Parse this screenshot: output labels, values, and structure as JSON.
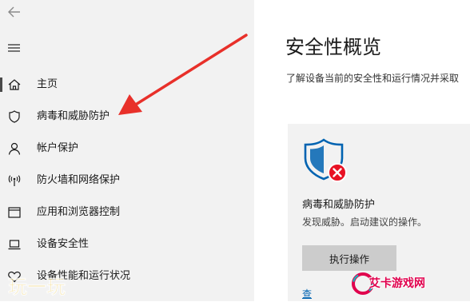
{
  "sidebar": {
    "items": [
      {
        "label": "主页",
        "icon": "home-icon",
        "active": true
      },
      {
        "label": "病毒和威胁防护",
        "icon": "shield-icon",
        "active": false
      },
      {
        "label": "帐户保护",
        "icon": "person-icon",
        "active": false
      },
      {
        "label": "防火墙和网络保护",
        "icon": "wifi-antenna-icon",
        "active": false
      },
      {
        "label": "应用和浏览器控制",
        "icon": "app-window-icon",
        "active": false
      },
      {
        "label": "设备安全性",
        "icon": "laptop-icon",
        "active": false
      },
      {
        "label": "设备性能和运行状况",
        "icon": "heart-icon",
        "active": false
      }
    ]
  },
  "main": {
    "title": "安全性概览",
    "subtitle": "了解设备当前的安全性和运行情况并采取",
    "card": {
      "title": "病毒和威胁防护",
      "description": "发现威胁。启动建议的操作。",
      "button_label": "执行操作",
      "link_label": "查",
      "status": "error"
    }
  },
  "watermarks": {
    "left_logo_text": "玩一玩",
    "right_logo_text": "艾卡游戏网"
  },
  "colors": {
    "sidebar_bg": "#f2f2f2",
    "card_bg": "#f2f2f2",
    "shield_blue": "#0063b1",
    "error_red": "#e81123",
    "arrow_red": "#e8302a",
    "link_blue": "#0063b1"
  }
}
